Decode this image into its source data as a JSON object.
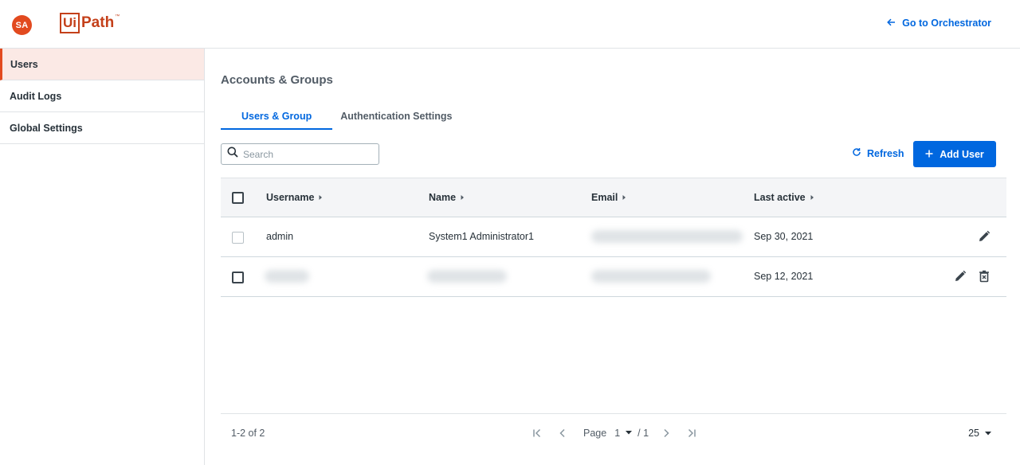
{
  "header": {
    "avatar_initials": "SA",
    "logo_box": "Ui",
    "logo_rest": "Path",
    "logo_tm": "™",
    "goto_label": "Go to Orchestrator"
  },
  "sidebar": {
    "items": [
      {
        "label": "Users",
        "active": true
      },
      {
        "label": "Audit Logs",
        "active": false
      },
      {
        "label": "Global Settings",
        "active": false
      }
    ]
  },
  "main": {
    "title": "Accounts & Groups",
    "tabs": [
      {
        "label": "Users & Group",
        "active": true
      },
      {
        "label": "Authentication Settings",
        "active": false
      }
    ],
    "search": {
      "placeholder": "Search",
      "value": ""
    },
    "refresh_label": "Refresh",
    "add_user_label": "Add User"
  },
  "table": {
    "columns": [
      "Username",
      "Name",
      "Email",
      "Last active"
    ],
    "rows": [
      {
        "username": "admin",
        "name": "System1 Administrator1",
        "email": "",
        "last_active": "Sep 30, 2021",
        "actions": [
          "edit-icon"
        ]
      },
      {
        "username": "",
        "name": "",
        "email": "",
        "last_active": "Sep 12, 2021",
        "actions": [
          "edit-icon",
          "delete-icon"
        ]
      }
    ]
  },
  "footer": {
    "range": "1-2 of 2",
    "page_label": "Page",
    "page_current": "1",
    "page_total": "/ 1",
    "page_size": "25"
  },
  "colors": {
    "accent": "#0067df",
    "brand": "#e24a1f",
    "active_bg": "#fbe9e5"
  }
}
